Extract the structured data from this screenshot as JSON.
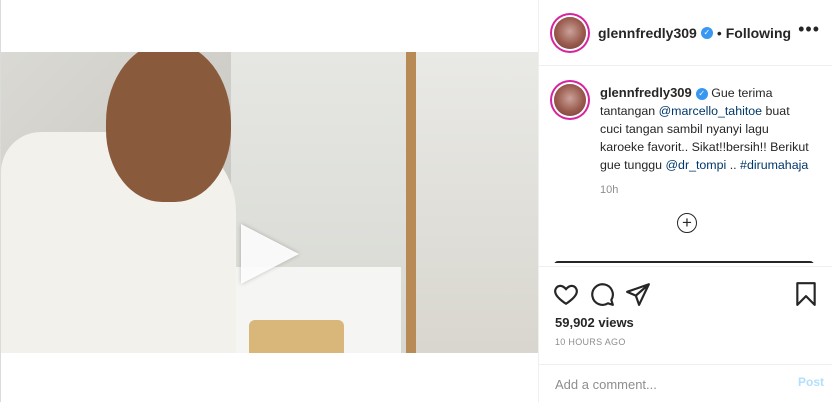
{
  "post": {
    "username": "glennfredly309",
    "dot": "•",
    "following_label": "Following",
    "more_icon": "more-horizontal-icon",
    "caption": {
      "username": "glennfredly309",
      "part1": " Gue terima tantangan ",
      "mention1": "@marcello_tahitoe",
      "part2": " buat cuci tangan sambil nyanyi lagu karoeke favorit.. Sikat!!bersih!! Berikut gue tunggu ",
      "mention2": "@dr_tompi",
      "part3": " .. ",
      "hashtag": "#dirumahaja"
    },
    "caption_time": "10h",
    "views": "59,902 views",
    "time_ago": "10 HOURS AGO",
    "comment_placeholder": "Add a comment...",
    "post_button": "Post"
  },
  "colors": {
    "link": "#00376b",
    "verified": "#3897f0",
    "post_button": "#b2dffc"
  },
  "icons": [
    "play-icon",
    "verified-icon",
    "plus-circle-icon",
    "heart-icon",
    "comment-icon",
    "share-icon",
    "bookmark-icon"
  ]
}
